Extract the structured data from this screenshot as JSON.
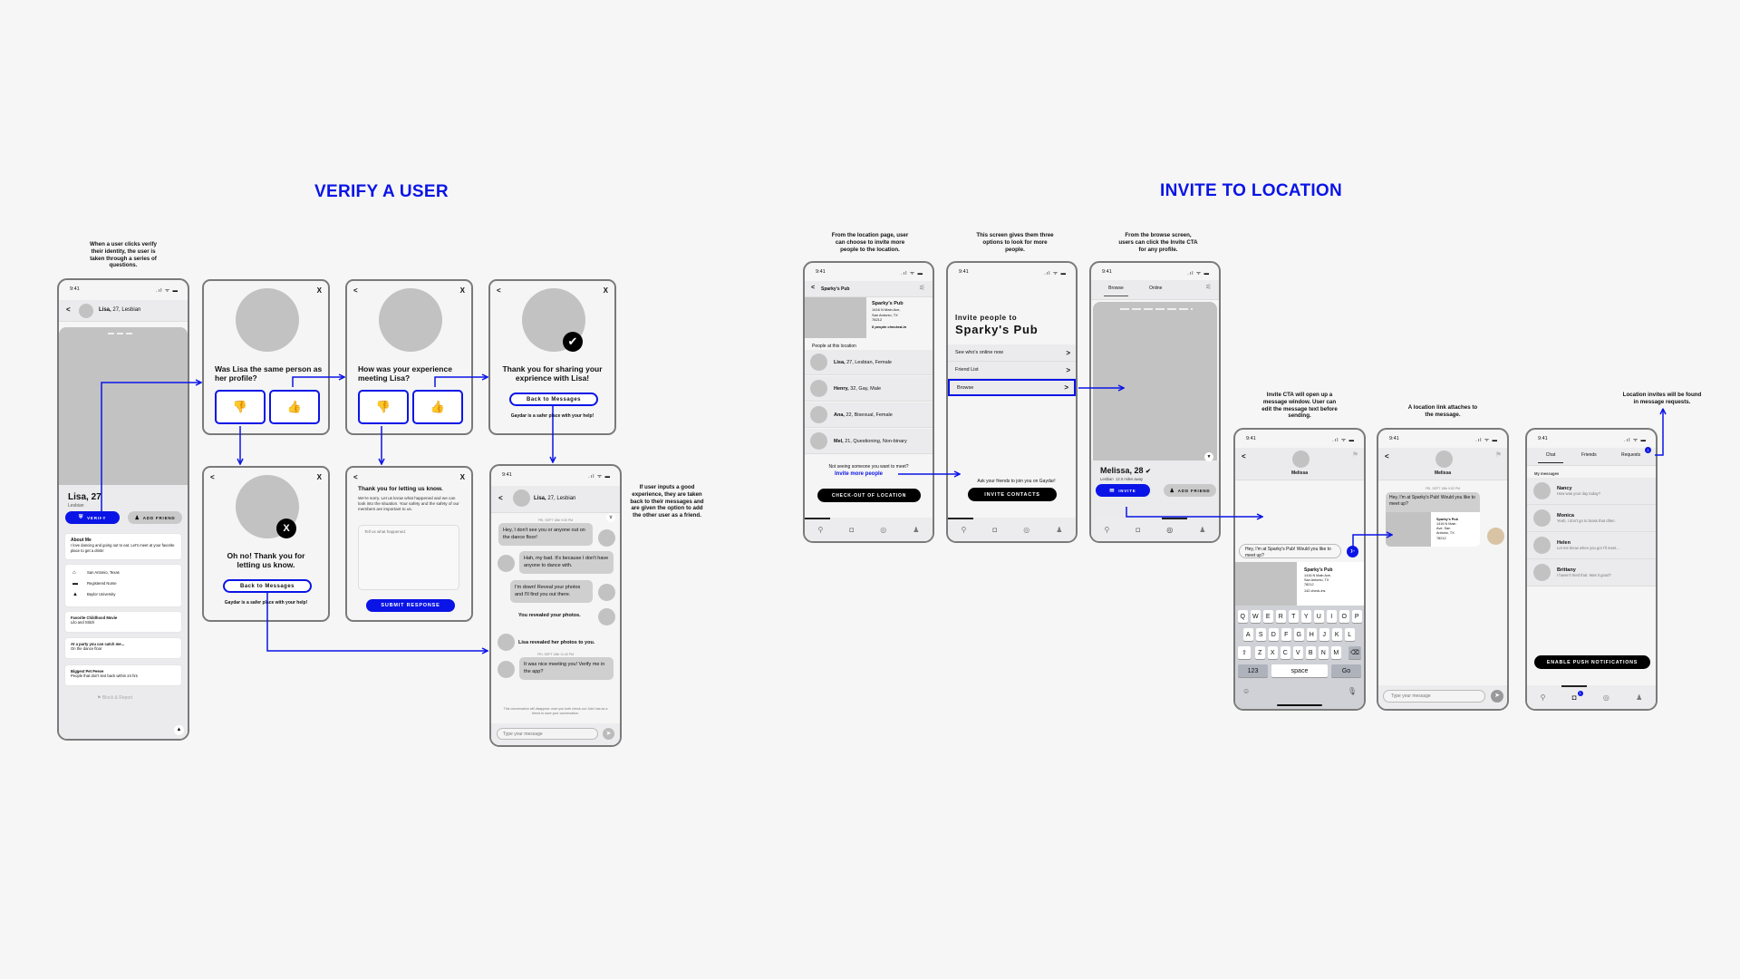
{
  "sections": {
    "verify_title": "VERIFY A USER",
    "invite_title": "INVITE TO  LOCATION"
  },
  "notes": {
    "verify_intro": "When a user clicks verify their identity, the user is taken through a series of questions.",
    "verify_good": "If user inputs a good experience, they are taken back to their messages and are given the option to add the other user as a friend.",
    "invite_location": "From the location page, user can choose to invite more people to the location.",
    "invite_options": "This screen gives them three options to look for more people.",
    "invite_browse": "From the browse screen, users can click the Invite CTA for any profile.",
    "invite_cta": "Invite CTA will open up a message window. User can edit the message text before sending.",
    "invite_link": "A location link attaches to the message.",
    "invite_requests": "Location invites will be found in message requests."
  },
  "common": {
    "time": "9:41",
    "signal": ".ıl ᯤ ▬",
    "close": "X",
    "back": "<",
    "type_message_placeholder": "Type your message",
    "safer": "Gaydar is a safer place with your help!",
    "back_to_messages": "Back to Messages"
  },
  "profile": {
    "header_name": "Lisa,",
    "header_meta": "27, Lesbian",
    "name": "Lisa, 27",
    "orientation": "Lesbian",
    "verify_label": "VERIFY",
    "add_friend_label": "ADD FRIEND",
    "about_title": "About Me",
    "about_text": "I love dancing and going out to eat. Let's meet at your favorite place to get a drink!",
    "facts": [
      {
        "icon": "home-icon",
        "glyph": "⌂",
        "text": "San Antonio, Texas"
      },
      {
        "icon": "briefcase-icon",
        "glyph": "▬",
        "text": "Registered Nurse"
      },
      {
        "icon": "graduation-cap-icon",
        "glyph": "▲",
        "text": "Baylor University"
      }
    ],
    "prompts": [
      {
        "title": "Favorite Childhood Movie",
        "answer": "Lilo and Stitch"
      },
      {
        "title": "At a party you can catch me...",
        "answer": "On the dance floor"
      },
      {
        "title": "Biggest Pet Peeve",
        "answer": "People that don't text back within 24 hrs"
      }
    ],
    "block_report": "Block & Report"
  },
  "q1": {
    "question": "Was Lisa the same person as her profile?"
  },
  "q2": {
    "question": "How was your experience meeting Lisa?"
  },
  "thanks_good": {
    "title": "Thank you for sharing your exprience with Lisa!"
  },
  "thanks_bad": {
    "title": "Oh no! Thank you for letting us know."
  },
  "feedback": {
    "title": "Thank you for letting us know.",
    "body": "We're sorry. Let us know what happened and we can look into the situation. Your safety and the safety of our members are important to us.",
    "placeholder": "Tell us what happened.",
    "submit": "SUBMIT RESPONSE"
  },
  "chat": {
    "header_name": "Lisa,",
    "header_meta": "27, Lesbian",
    "timestamp1": "FRI, SEPT 18th 9:50 PM",
    "messages": [
      "Hey, I don't see you or anyone out on the dance floor!",
      "Hah, my bad. It's because I don't have anyone to dance with.",
      "I'm down! Reveal your photos and I'll find you out there."
    ],
    "you_revealed": "You revealed your photos.",
    "lisa_revealed": "Lisa revealed her photos to you.",
    "timestamp2": "FRI, SEPT 18th 11:40 PM",
    "last_message": "It was nice meeting you! Verify me in the app?",
    "disclaimer": "This conversation will disappear once you both check-out. Add Lisa as a friend to save your conversation."
  },
  "location": {
    "header": "Sparky's Pub",
    "name": "Sparky's Pub",
    "address": [
      "1416 N Main Ave,",
      "San Antonio, TX",
      "78212"
    ],
    "checked_in": "8 people checked-in",
    "people_label": "People at this location",
    "people": [
      {
        "name": "Lisa,",
        "meta": "27, Lesbian, Female"
      },
      {
        "name": "Henry,",
        "meta": "32, Gay, Male"
      },
      {
        "name": "Ana,",
        "meta": "22, Bisexual, Female"
      },
      {
        "name": "Mel,",
        "meta": "21, Questioning, Non-binary"
      }
    ],
    "not_seeing": "Not seeing someone you want to meet?",
    "invite_more": "Invite more people",
    "checkout": "CHECK-OUT OF LOCATION"
  },
  "invite": {
    "title_line1": "Invite people to",
    "title_line2": "Sparky's Pub",
    "options": [
      "See who's online now",
      "Friend List",
      "Browse"
    ],
    "ask_friends": "Ask your friends to join you on Gaydar!",
    "invite_contacts": "INVITE CONTACTS"
  },
  "browse": {
    "tabs": [
      "Browse",
      "Online"
    ],
    "name": "Melissa, 28",
    "orientation": "Lesbian",
    "distance": "12.0 miles away",
    "invite_label": "INVITE",
    "add_friend_label": "ADD FRIEND"
  },
  "compose": {
    "contact": "Melissa",
    "draft": "Hey, I'm at Sparky's Pub! Would you like to meet up?",
    "loc_name": "Sparky's Pub",
    "loc_address": [
      "1416 N Main Ave,",
      "San Antonio, TX",
      "78212"
    ],
    "loc_checkins": "142 check-ins",
    "keyboard_rows": [
      [
        "Q",
        "W",
        "E",
        "R",
        "T",
        "Y",
        "U",
        "I",
        "O",
        "P"
      ],
      [
        "A",
        "S",
        "D",
        "F",
        "G",
        "H",
        "J",
        "K",
        "L"
      ],
      [
        "Z",
        "X",
        "C",
        "V",
        "B",
        "N",
        "M"
      ]
    ],
    "key_123": "123",
    "key_space": "space",
    "key_go": "Go"
  },
  "sent": {
    "contact": "Melissa",
    "timestamp": "FRI, SEPT 18th 9:52 PM",
    "message": "Hey, I'm at Sparky's Pub! Would you like to meet up?",
    "loc_name": "Sparky's Pub",
    "loc_address": [
      "1416 N Main",
      "Ave, San",
      "Antonio, TX",
      "78212"
    ]
  },
  "inbox": {
    "tabs": [
      "Chat",
      "Friends",
      "Requests"
    ],
    "requests_badge": "1",
    "section_label": "My messages",
    "threads": [
      {
        "name": "Nancy",
        "preview": "How was your day today?"
      },
      {
        "name": "Monica",
        "preview": "Yeah, I don't go to brass that often."
      },
      {
        "name": "Helen",
        "preview": "Let me know when you go! I'll meet..."
      },
      {
        "name": "Brittany",
        "preview": "I haven't tried that. Was it good?"
      }
    ],
    "push_cta": "ENABLE PUSH NOTIFICATIONS",
    "chat_badge": "1"
  },
  "colors": {
    "accent": "#0a14e6",
    "placeholder": "#c2c2c2",
    "frame": "#7a7a7a"
  }
}
